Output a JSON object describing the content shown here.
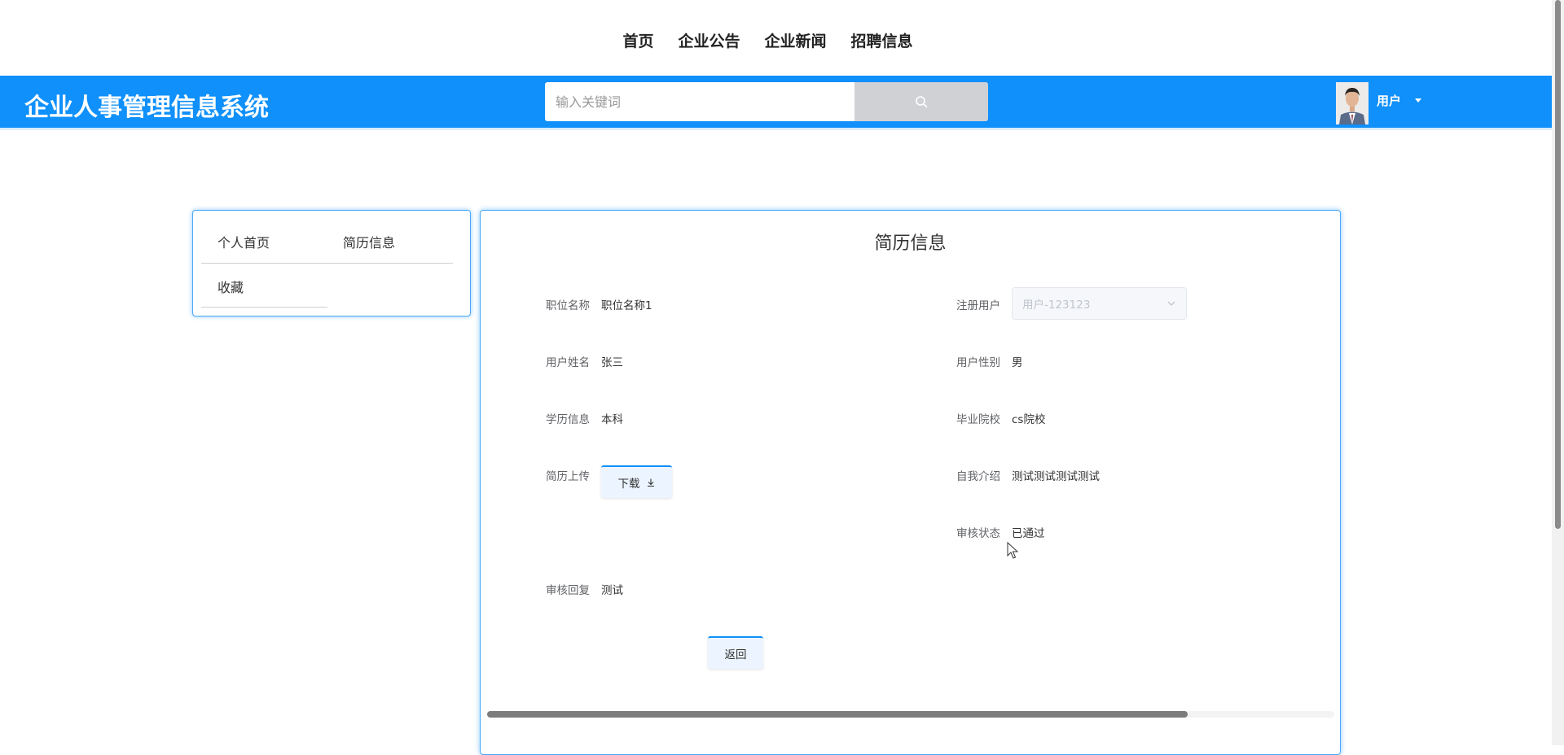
{
  "topnav": [
    "首页",
    "企业公告",
    "企业新闻",
    "招聘信息"
  ],
  "header": {
    "logo": "企业人事管理信息系统",
    "search_placeholder": "输入关键词",
    "search_icon": "search-icon",
    "user_name": "用户"
  },
  "colors": {
    "primary": "#0f90fb",
    "border": "#4aa9f8",
    "button_bg": "#ecf5ff"
  },
  "sidebar": {
    "items": [
      "个人首页",
      "简历信息",
      "收藏"
    ]
  },
  "panel": {
    "title": "简历信息",
    "fields": {
      "job_title": {
        "label": "职位名称",
        "value": "职位名称1"
      },
      "reg_user": {
        "label": "注册用户",
        "value": "用户-123123"
      },
      "user_name": {
        "label": "用户姓名",
        "value": "张三"
      },
      "user_gender": {
        "label": "用户性别",
        "value": "男"
      },
      "education": {
        "label": "学历信息",
        "value": "本科"
      },
      "school": {
        "label": "毕业院校",
        "value": "cs院校"
      },
      "resume_upload": {
        "label": "简历上传",
        "button": "下载"
      },
      "self_intro": {
        "label": "自我介绍",
        "value": "测试测试测试测试"
      },
      "review_status": {
        "label": "审核状态",
        "value": "已通过"
      },
      "review_reply": {
        "label": "审核回复",
        "value": "测试"
      }
    },
    "back_button": "返回"
  }
}
